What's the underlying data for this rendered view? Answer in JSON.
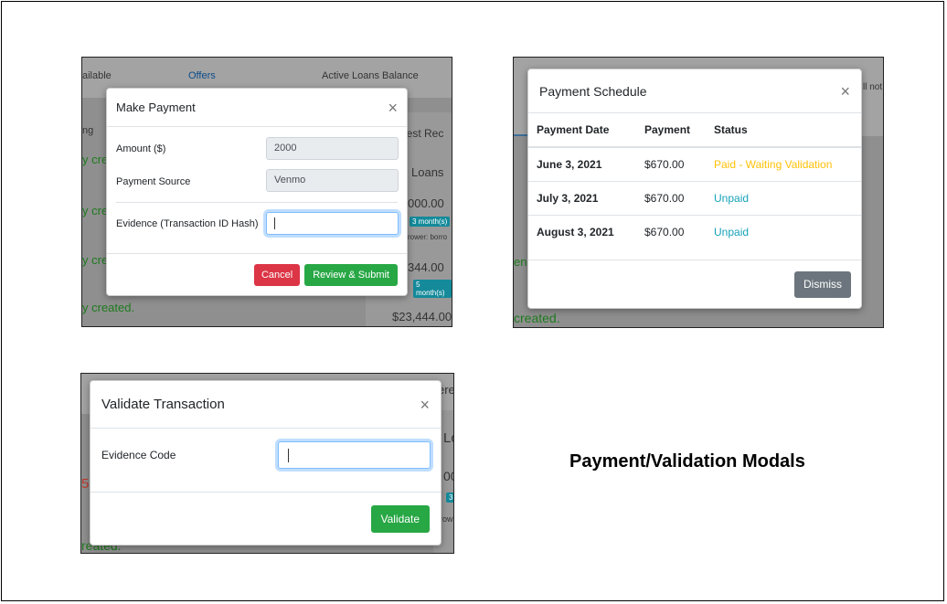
{
  "background_fragments": {
    "shot1": {
      "available": "ailable",
      "offers": "Offers",
      "active_loans_balance": "Active Loans Balance",
      "ng": "ng",
      "y_cre_1": "y cre",
      "y_cre_2": "y cre",
      "y_cre_3": "y cre",
      "created": "y created.",
      "interest": "erest Rec",
      "loans": "Loans",
      "amt1": "000.00",
      "badge1": "3 month(s)",
      "borrower": "rower: borro",
      "amt2": "344.00",
      "badge2": "5 month(s)",
      "amt3": "$23,444.00"
    },
    "shot2": {
      "not": "ll not",
      "enc": "enc",
      "created": "created."
    },
    "shot3": {
      "ere": "ere",
      "lo": "Lo",
      "five": "5",
      "zero": "00",
      "three": "3",
      "row": "row",
      "created": "reated."
    }
  },
  "make_payment": {
    "title": "Make Payment",
    "close": "×",
    "amount_label": "Amount ($)",
    "amount_value": "2000",
    "source_label": "Payment Source",
    "source_value": "Venmo",
    "evidence_label": "Evidence (Transaction ID Hash)",
    "evidence_value": "",
    "cancel_label": "Cancel",
    "submit_label": "Review & Submit"
  },
  "payment_schedule": {
    "title": "Payment Schedule",
    "close": "×",
    "columns": [
      "Payment Date",
      "Payment",
      "Status"
    ],
    "rows": [
      {
        "date": "June 3, 2021",
        "payment": "$670.00",
        "status": "Paid - Waiting Validation"
      },
      {
        "date": "July 3, 2021",
        "payment": "$670.00",
        "status": "Unpaid"
      },
      {
        "date": "August 3, 2021",
        "payment": "$670.00",
        "status": "Unpaid"
      }
    ],
    "dismiss_label": "Dismiss"
  },
  "validate_transaction": {
    "title": "Validate Transaction",
    "close": "×",
    "evidence_label": "Evidence Code",
    "evidence_value": "",
    "validate_label": "Validate"
  },
  "caption": "Payment/Validation Modals",
  "colors": {
    "danger": "#dc3545",
    "success": "#28a745",
    "secondary": "#6c757d",
    "warning": "#ffc107",
    "info": "#17a2b8",
    "focus": "#80bdff"
  },
  "icons": [
    "close-icon"
  ]
}
